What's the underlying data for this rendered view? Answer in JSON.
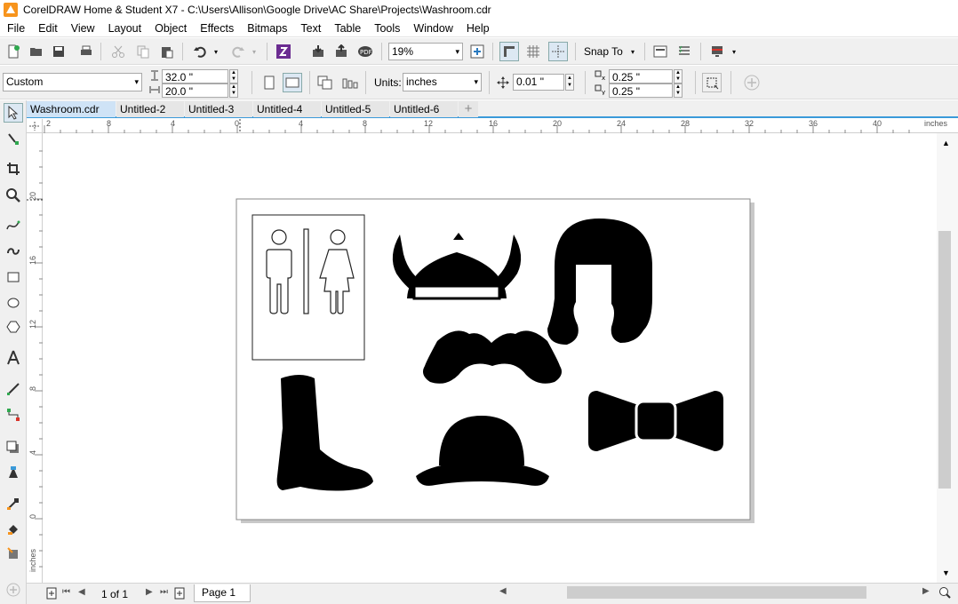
{
  "window": {
    "title": "CorelDRAW Home & Student X7 - C:\\Users\\Allison\\Google Drive\\AC Share\\Projects\\Washroom.cdr",
    "accent_color": "#3a9ad9"
  },
  "menu": [
    "File",
    "Edit",
    "View",
    "Layout",
    "Object",
    "Effects",
    "Bitmaps",
    "Text",
    "Table",
    "Tools",
    "Window",
    "Help"
  ],
  "standard_toolbar": {
    "icons": [
      "new-document-icon",
      "open-icon",
      "save-icon",
      "print-icon",
      "cut-icon",
      "copy-icon",
      "paste-icon",
      "undo-icon",
      "redo-icon",
      "corel-connect-icon",
      "import-icon",
      "export-icon",
      "publish-pdf-icon",
      "full-screen-icon",
      "show-rulers-icon",
      "show-grid-icon",
      "show-guidelines-icon",
      "options-icon",
      "application-launcher-icon"
    ],
    "zoom_value": "19%",
    "snap_to_label": "Snap To"
  },
  "property_bar": {
    "page_preset": "Custom",
    "page_width": "32.0 \"",
    "page_height": "20.0 \"",
    "units_label": "Units:",
    "units_value": "inches",
    "nudge_value": "0.01 \"",
    "duplicate_x": "0.25 \"",
    "duplicate_y": "0.25 \""
  },
  "document_tabs": [
    {
      "label": "Washroom.cdr",
      "active": true
    },
    {
      "label": "Untitled-2",
      "active": false
    },
    {
      "label": "Untitled-3",
      "active": false
    },
    {
      "label": "Untitled-4",
      "active": false
    },
    {
      "label": "Untitled-5",
      "active": false
    },
    {
      "label": "Untitled-6",
      "active": false
    }
  ],
  "toolbox": [
    "pick-tool-icon",
    "shape-tool-icon",
    "crop-tool-icon",
    "zoom-tool-icon",
    "freehand-tool-icon",
    "artistic-media-icon",
    "rectangle-tool-icon",
    "ellipse-tool-icon",
    "polygon-tool-icon",
    "text-tool-icon",
    "parallel-dimension-icon",
    "connector-tool-icon",
    "drop-shadow-icon",
    "transparency-tool-icon",
    "eyedropper-tool-icon",
    "interactive-fill-icon",
    "smart-fill-icon"
  ],
  "rulers": {
    "unit_label": "inches",
    "horizontal_ticks": [
      "2",
      "8",
      "4",
      "0",
      "4",
      "8",
      "12",
      "16",
      "20",
      "24",
      "28",
      "32",
      "36",
      "40"
    ],
    "vertical_ticks": [
      "20",
      "16",
      "12",
      "8",
      "4",
      "0"
    ]
  },
  "artwork": [
    "washroom-sign",
    "viking-helmet",
    "wig",
    "mustache",
    "cowboy-boot",
    "bowler-hat",
    "bow-tie"
  ],
  "status": {
    "page_count": "1 of 1",
    "page_tab": "Page 1"
  }
}
